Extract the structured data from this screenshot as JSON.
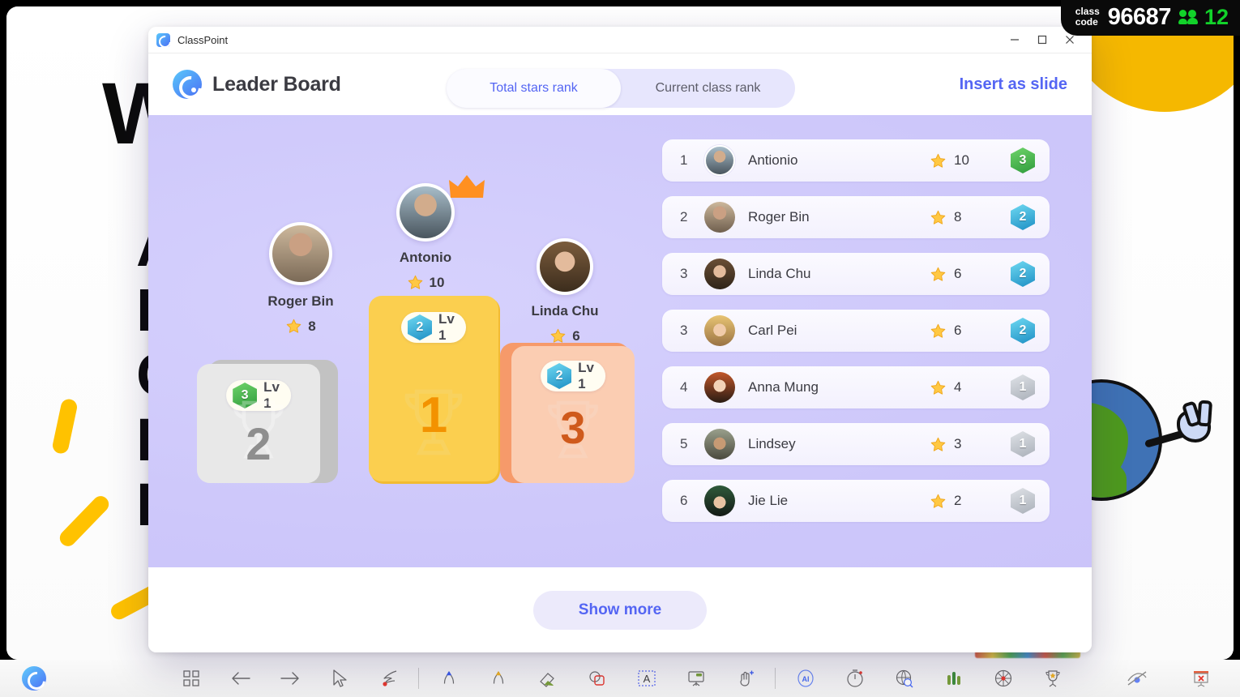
{
  "class_badge": {
    "label_line1": "class",
    "label_line2": "code",
    "code": "96687",
    "participants": "12",
    "participants_icon": "people-icon",
    "accent": "#12d22a"
  },
  "slide": {
    "title": "W",
    "letters": [
      "A",
      "B",
      "C",
      "D",
      "E"
    ],
    "decor": [
      "yellow-dash",
      "yellow-dash",
      "yellow-dash",
      "yellow-circle",
      "earth-character"
    ]
  },
  "window": {
    "app_title": "ClassPoint",
    "app_icon": "classpoint-logo-icon",
    "controls": {
      "minimize": "minimize-icon",
      "maximize": "maximize-icon",
      "close": "close-icon"
    }
  },
  "header": {
    "logo_icon": "classpoint-logo-icon",
    "title": "Leader Board",
    "tabs": [
      {
        "label": "Total stars rank",
        "active": true
      },
      {
        "label": "Current class rank",
        "active": false
      }
    ],
    "insert_label": "Insert as slide",
    "accent": "#5465f3"
  },
  "podium": {
    "crown_icon": "crown-icon",
    "star_icon": "star-icon",
    "trophy_icon": "trophy-icon",
    "winners": [
      {
        "place": "2",
        "name": "Roger Bin",
        "stars": "8",
        "level": "Lv 1",
        "badge_num": "3",
        "badge_color": "#3fae4a",
        "block_color": "#e8e8e8",
        "block_shadow": "#c2c2c2",
        "num_color": "#8e8e8e"
      },
      {
        "place": "1",
        "name": "Antonio",
        "stars": "10",
        "level": "Lv 1",
        "badge_num": "2",
        "badge_color": "#2fb3dd",
        "block_color": "#fbcf4f",
        "block_shadow": "#f2bb31",
        "num_color": "#f39200"
      },
      {
        "place": "3",
        "name": "Linda Chu",
        "stars": "6",
        "level": "Lv 1",
        "badge_num": "2",
        "badge_color": "#2fb3dd",
        "block_color": "#fbcdb2",
        "block_shadow": "#f69a6a",
        "num_color": "#cf5a1c"
      }
    ]
  },
  "leaderboard": {
    "star_icon": "star-icon",
    "rows": [
      {
        "rank": "1",
        "name": "Antionio",
        "stars": "10",
        "level": "3",
        "level_color": "#3fae4a",
        "highlight": true
      },
      {
        "rank": "2",
        "name": "Roger Bin",
        "stars": "8",
        "level": "2",
        "level_color": "#2fb3dd",
        "highlight": false
      },
      {
        "rank": "3",
        "name": "Linda Chu",
        "stars": "6",
        "level": "2",
        "level_color": "#2fb3dd",
        "highlight": false
      },
      {
        "rank": "3",
        "name": "Carl Pei",
        "stars": "6",
        "level": "2",
        "level_color": "#2fb3dd",
        "highlight": false
      },
      {
        "rank": "4",
        "name": "Anna Mung",
        "stars": "4",
        "level": "1",
        "level_color": "#b9bcc4",
        "highlight": false
      },
      {
        "rank": "5",
        "name": "Lindsey",
        "stars": "3",
        "level": "1",
        "level_color": "#b9bcc4",
        "highlight": false
      },
      {
        "rank": "6",
        "name": "Jie Lie",
        "stars": "2",
        "level": "1",
        "level_color": "#b9bcc4",
        "highlight": false
      }
    ]
  },
  "footer": {
    "show_more_label": "Show more"
  },
  "toolbar": {
    "logo_icon": "classpoint-logo-icon",
    "items": [
      {
        "icon": "grid-slides-icon"
      },
      {
        "icon": "arrow-left-icon"
      },
      {
        "icon": "arrow-right-icon"
      },
      {
        "icon": "cursor-pointer-icon"
      },
      {
        "icon": "laser-pointer-icon"
      },
      {
        "icon": "separator"
      },
      {
        "icon": "pen-blue-icon"
      },
      {
        "icon": "highlighter-yellow-icon"
      },
      {
        "icon": "eraser-icon"
      },
      {
        "icon": "shapes-icon"
      },
      {
        "icon": "text-box-icon"
      },
      {
        "icon": "whiteboard-icon"
      },
      {
        "icon": "drag-hand-icon"
      },
      {
        "icon": "separator"
      },
      {
        "icon": "ai-icon"
      },
      {
        "icon": "timer-icon"
      },
      {
        "icon": "browser-search-icon"
      },
      {
        "icon": "bar-chart-icon"
      },
      {
        "icon": "spinner-wheel-icon"
      },
      {
        "icon": "trophy-award-icon"
      }
    ],
    "right_items": [
      {
        "icon": "hide-annotation-icon"
      },
      {
        "icon": "end-show-icon"
      }
    ]
  }
}
